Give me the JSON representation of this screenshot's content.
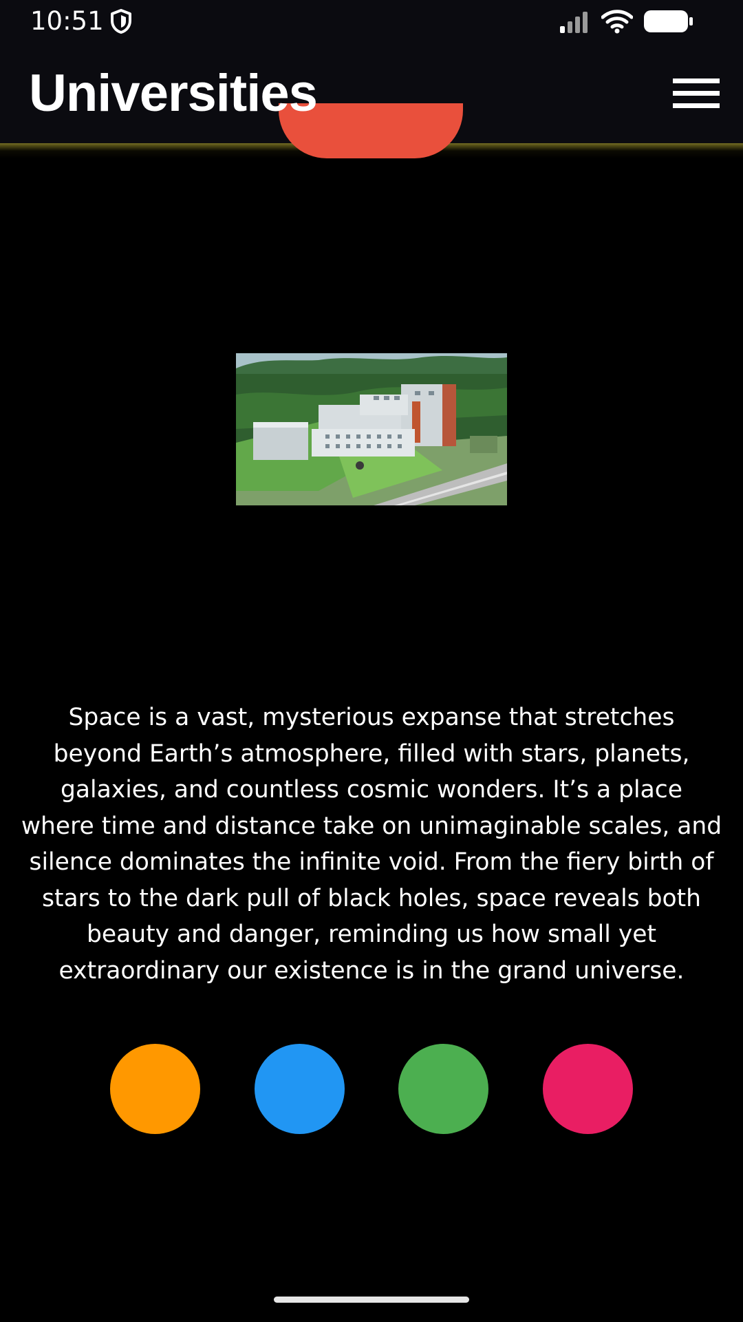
{
  "status_bar": {
    "time": "10:51",
    "icons": [
      "shield-icon",
      "signal-icon",
      "wifi-icon",
      "battery-icon"
    ]
  },
  "app_bar": {
    "title": "Universities",
    "menu_icon": "hamburger-menu-icon"
  },
  "main": {
    "image": {
      "subject": "campus-image"
    },
    "description": "Space is a vast, mysterious expanse that stretches beyond Earth’s atmosphere, filled with stars, planets, galaxies, and countless cosmic wonders. It’s a place where time and distance take on unimaginable scales, and silence dominates the infinite void. From the fiery birth of stars to the dark pull of black holes, space reveals both beauty and danger, reminding us how small yet extraordinary our existence is in the grand universe.",
    "color_buttons": [
      {
        "name": "orange",
        "color": "#ff9800"
      },
      {
        "name": "blue",
        "color": "#2196f3"
      },
      {
        "name": "green",
        "color": "#4caf50"
      },
      {
        "name": "pink",
        "color": "#e91e63"
      }
    ]
  },
  "colors": {
    "background": "#000000",
    "app_bar": "#0b0b10",
    "accent": "#e9503c",
    "text": "#ffffff"
  }
}
